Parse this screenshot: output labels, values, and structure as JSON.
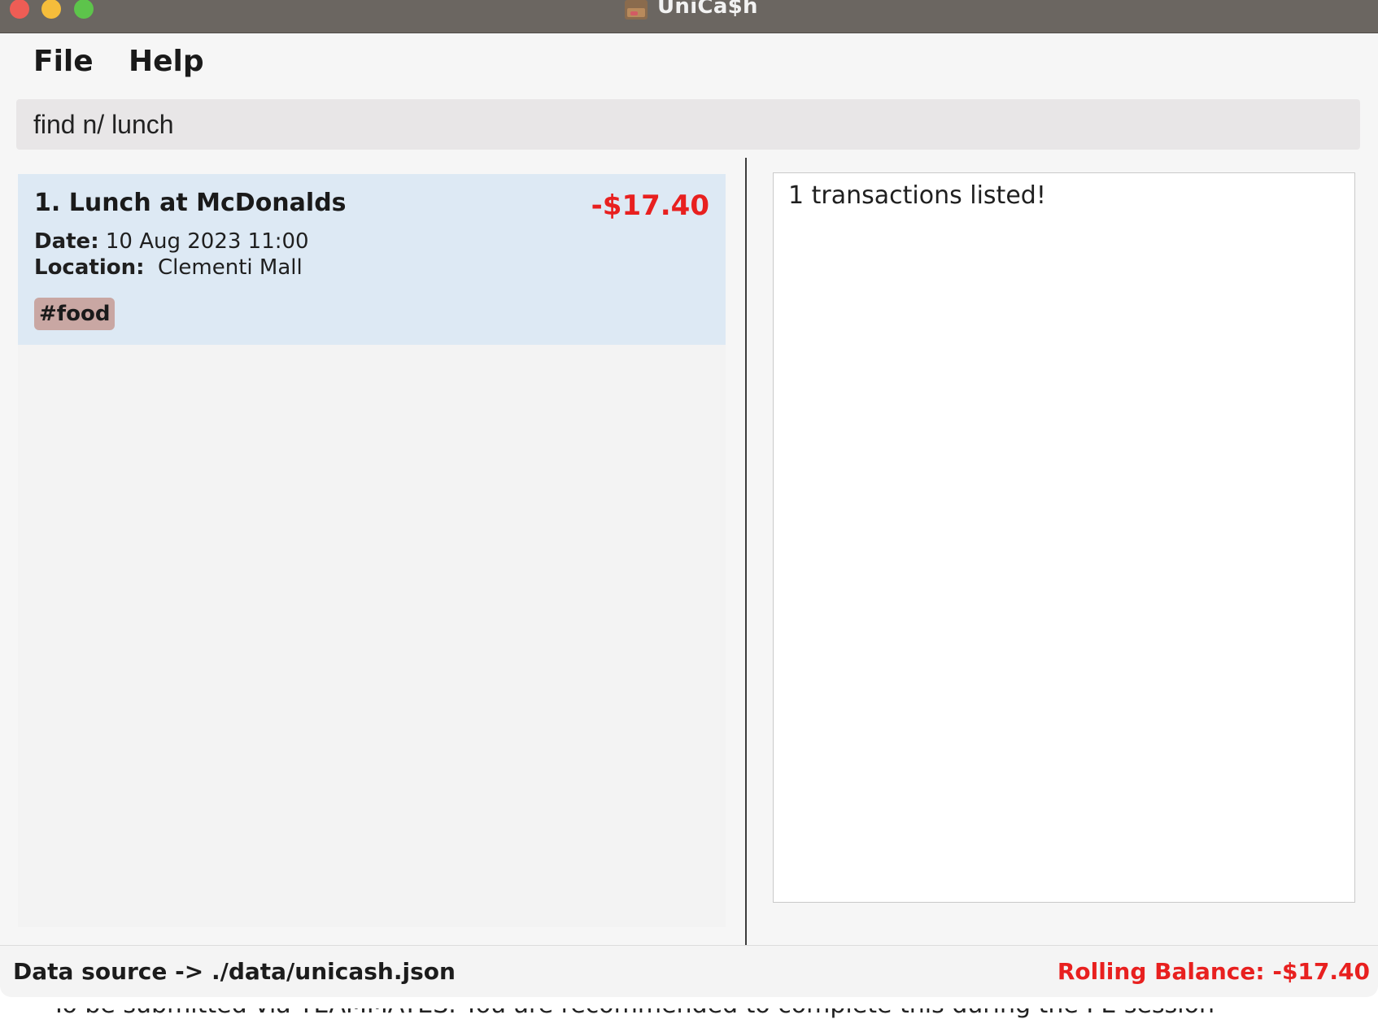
{
  "window": {
    "title": "UniCa$h"
  },
  "menu": {
    "file_label": "File",
    "help_label": "Help"
  },
  "command": {
    "value": "find n/ lunch"
  },
  "transactions": [
    {
      "title": "1. Lunch at McDonalds",
      "amount": "-$17.40",
      "date_label": "Date:",
      "date_value": "10 Aug 2023 11:00",
      "location_label": "Location:",
      "location_value": "Clementi Mall",
      "tag": "#food"
    }
  ],
  "result": {
    "message": "1 transactions listed!"
  },
  "status": {
    "data_source": "Data source -> ./data/unicash.json",
    "rolling_balance": "Rolling Balance: -$17.40"
  },
  "background": {
    "text": "To be submitted via TEAMMATES. You are recommended to complete this during the PE session"
  },
  "colors": {
    "negative_amount": "#e8201f",
    "selected_card": "#dde9f4",
    "tag_bg": "#c9a7a3",
    "titlebar": "#6b6661"
  }
}
